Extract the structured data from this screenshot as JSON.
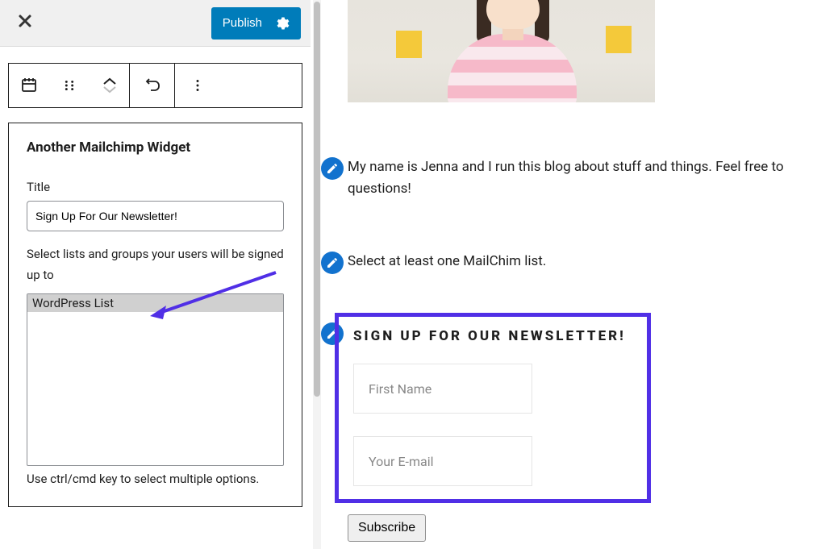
{
  "header": {
    "publish_label": "Publish"
  },
  "widget": {
    "heading": "Another Mailchimp Widget",
    "title_label": "Title",
    "title_value": "Sign Up For Our Newsletter!",
    "lists_label": "Select lists and groups your users will be signed up to",
    "list_options": [
      "WordPress List"
    ],
    "lists_hint": "Use ctrl/cmd key to select multiple options."
  },
  "preview": {
    "intro": "My name is Jenna and I run this blog about stuff and things. Feel free to questions!",
    "warning": "Select at least one MailChim list.",
    "signup_heading": "SIGN UP FOR OUR NEWSLETTER!",
    "first_name_ph": "First Name",
    "email_ph": "Your E-mail",
    "subscribe_label": "Subscribe"
  }
}
